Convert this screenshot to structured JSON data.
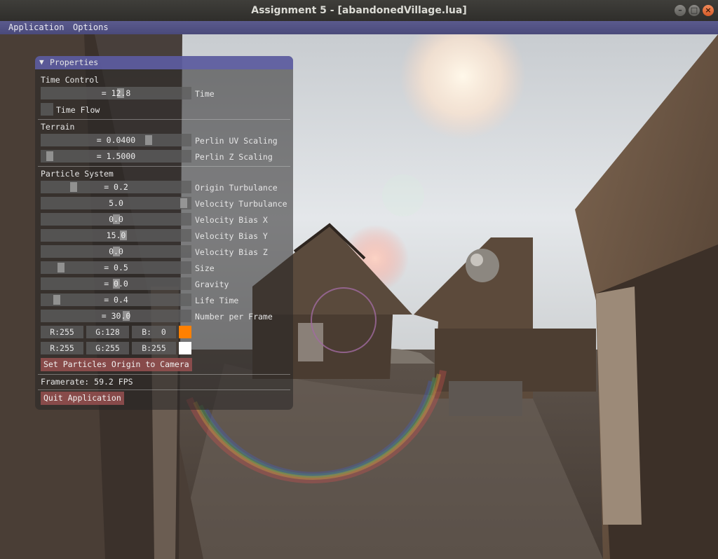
{
  "window": {
    "title": "Assignment 5 - [abandonedVillage.lua]"
  },
  "menubar": {
    "items": [
      "Application",
      "Options"
    ]
  },
  "panel": {
    "title": "Properties",
    "sections": {
      "time": {
        "label": "Time Control",
        "time_slider": {
          "display": "= 12.8",
          "label": "Time",
          "fill": 0.53
        },
        "time_flow": {
          "label": "Time Flow",
          "checked": false
        }
      },
      "terrain": {
        "label": "Terrain",
        "perlin_uv": {
          "display": "= 0.0400",
          "label": "Perlin UV Scaling",
          "fill": 0.73
        },
        "perlin_z": {
          "display": "= 1.5000",
          "label": "Perlin Z Scaling",
          "fill": 0.03
        }
      },
      "particles": {
        "label": "Particle System",
        "sliders": [
          {
            "display": "= 0.2",
            "label": "Origin Turbulance",
            "fill": 0.2
          },
          {
            "display": "5.0",
            "label": "Velocity Turbulance",
            "fill": 0.98
          },
          {
            "display": "0.0",
            "label": "Velocity Bias X",
            "fill": 0.5
          },
          {
            "display": "15.0",
            "label": "Velocity Bias Y",
            "fill": 0.55
          },
          {
            "display": "0.0",
            "label": "Velocity Bias Z",
            "fill": 0.5
          },
          {
            "display": "= 0.5",
            "label": "Size",
            "fill": 0.11
          },
          {
            "display": "= 0.0",
            "label": "Gravity",
            "fill": 0.5
          },
          {
            "display": "= 0.4",
            "label": "Life Time",
            "fill": 0.08
          },
          {
            "display": "= 30.0",
            "label": "Number per Frame",
            "fill": 0.57
          }
        ],
        "color1": {
          "r": "R:255",
          "g": "G:128",
          "b": "B:  0",
          "swatch": "#ff8000"
        },
        "color2": {
          "r": "R:255",
          "g": "G:255",
          "b": "B:255",
          "swatch": "#ffffff"
        },
        "origin_button": "Set Particles Origin to Camera"
      },
      "stats": {
        "framerate": "Framerate: 59.2 FPS"
      },
      "quit_button": "Quit Application"
    }
  }
}
